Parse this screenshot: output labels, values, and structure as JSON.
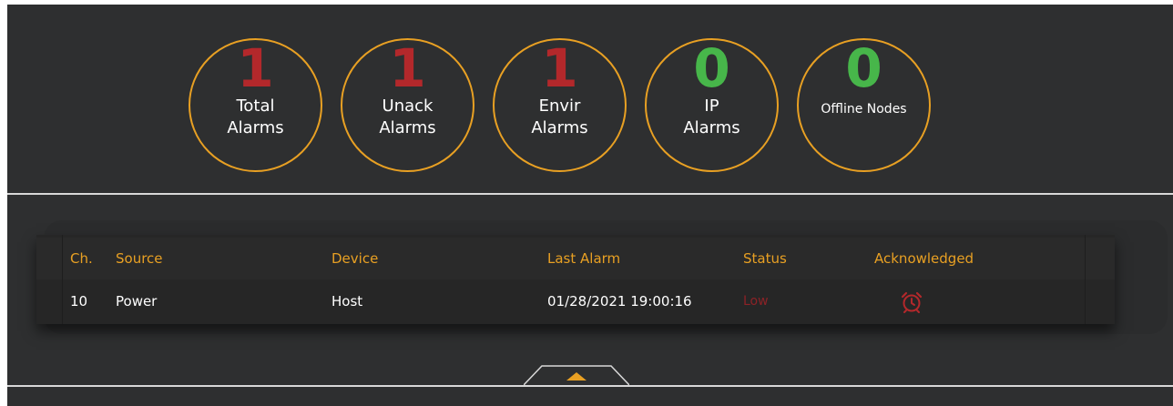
{
  "counters": [
    {
      "value": "1",
      "label_line1": "Total",
      "label_line2": "Alarms",
      "color": "#b3282b"
    },
    {
      "value": "1",
      "label_line1": "Unack",
      "label_line2": "Alarms",
      "color": "#b3282b"
    },
    {
      "value": "1",
      "label_line1": "Envir",
      "label_line2": "Alarms",
      "color": "#b3282b"
    },
    {
      "value": "0",
      "label_line1": "IP",
      "label_line2": "Alarms",
      "color": "#47b64a"
    },
    {
      "value": "0",
      "label": "Offline Nodes",
      "color": "#47b64a"
    }
  ],
  "table": {
    "headers": {
      "ch": "Ch.",
      "source": "Source",
      "device": "Device",
      "last_alarm": "Last Alarm",
      "status": "Status",
      "acknowledged": "Acknowledged"
    },
    "rows": [
      {
        "ch": "10",
        "source": "Power",
        "device": "Host",
        "last_alarm": "01/28/2021 19:00:16",
        "status": "Low",
        "acknowledged_icon": "alarm-clock-icon"
      }
    ]
  },
  "colors": {
    "accent": "#e8a023",
    "alarm_red": "#b3282b",
    "ok_green": "#47b64a",
    "panel_bg": "#2e2f30"
  },
  "handle_icon": "caret-up-icon"
}
